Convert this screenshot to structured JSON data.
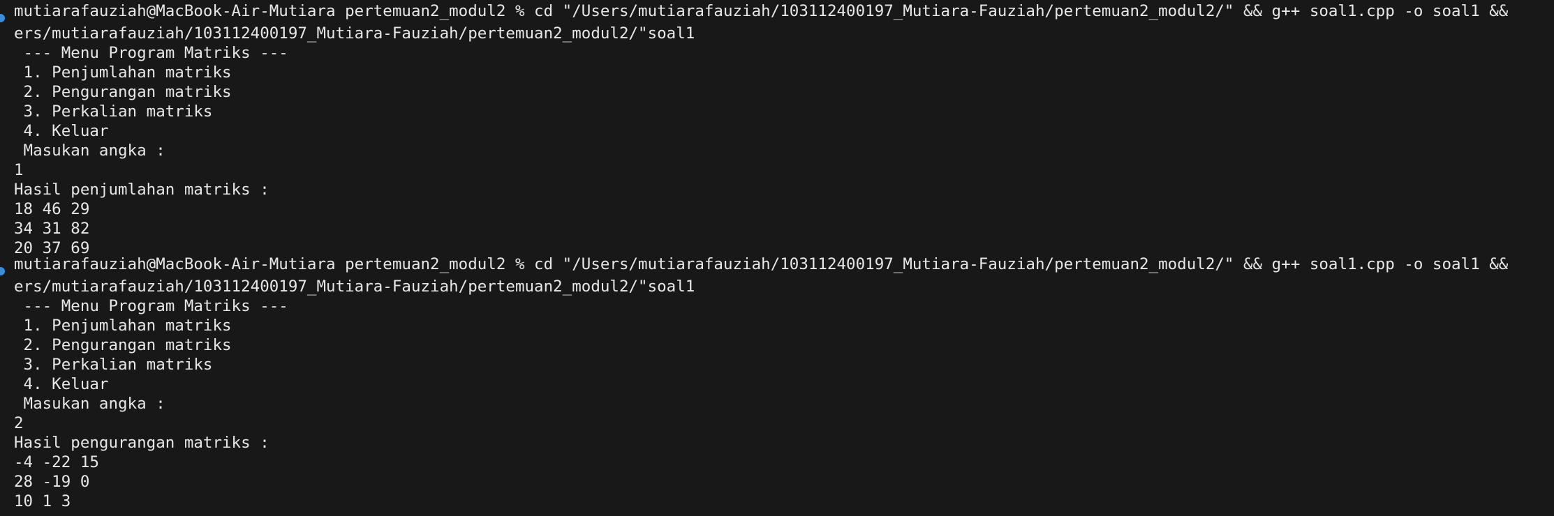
{
  "terminal": {
    "colors": {
      "background": "#181818",
      "text": "#e7e7e7",
      "prompt_marker": "#3b8ed6"
    },
    "blocks": [
      {
        "marker": "command-success-dot",
        "command": "mutiarafauziah@MacBook-Air-Mutiara pertemuan2_modul2 % cd \"/Users/mutiarafauziah/103112400197_Mutiara-Fauziah/pertemuan2_modul2/\" && g++ soal1.cpp -o soal1 &&",
        "command_wrap": "ers/mutiarafauziah/103112400197_Mutiara-Fauziah/pertemuan2_modul2/\"soal1",
        "menu_title": " --- Menu Program Matriks ---",
        "menu_items": [
          " 1. Penjumlahan matriks",
          " 2. Pengurangan matriks",
          " 3. Perkalian matriks",
          " 4. Keluar"
        ],
        "prompt": " Masukan angka :",
        "input": "1",
        "result_title": "Hasil penjumlahan matriks :",
        "result_rows": [
          "18 46 29",
          "34 31 82",
          "20 37 69"
        ]
      },
      {
        "marker": "command-success-dot",
        "command": "mutiarafauziah@MacBook-Air-Mutiara pertemuan2_modul2 % cd \"/Users/mutiarafauziah/103112400197_Mutiara-Fauziah/pertemuan2_modul2/\" && g++ soal1.cpp -o soal1 &&",
        "command_wrap": "ers/mutiarafauziah/103112400197_Mutiara-Fauziah/pertemuan2_modul2/\"soal1",
        "menu_title": " --- Menu Program Matriks ---",
        "menu_items": [
          " 1. Penjumlahan matriks",
          " 2. Pengurangan matriks",
          " 3. Perkalian matriks",
          " 4. Keluar"
        ],
        "prompt": " Masukan angka :",
        "input": "2",
        "result_title": "Hasil pengurangan matriks :",
        "result_rows": [
          "-4 -22 15",
          "28 -19 0",
          "10 1 3"
        ]
      }
    ]
  }
}
